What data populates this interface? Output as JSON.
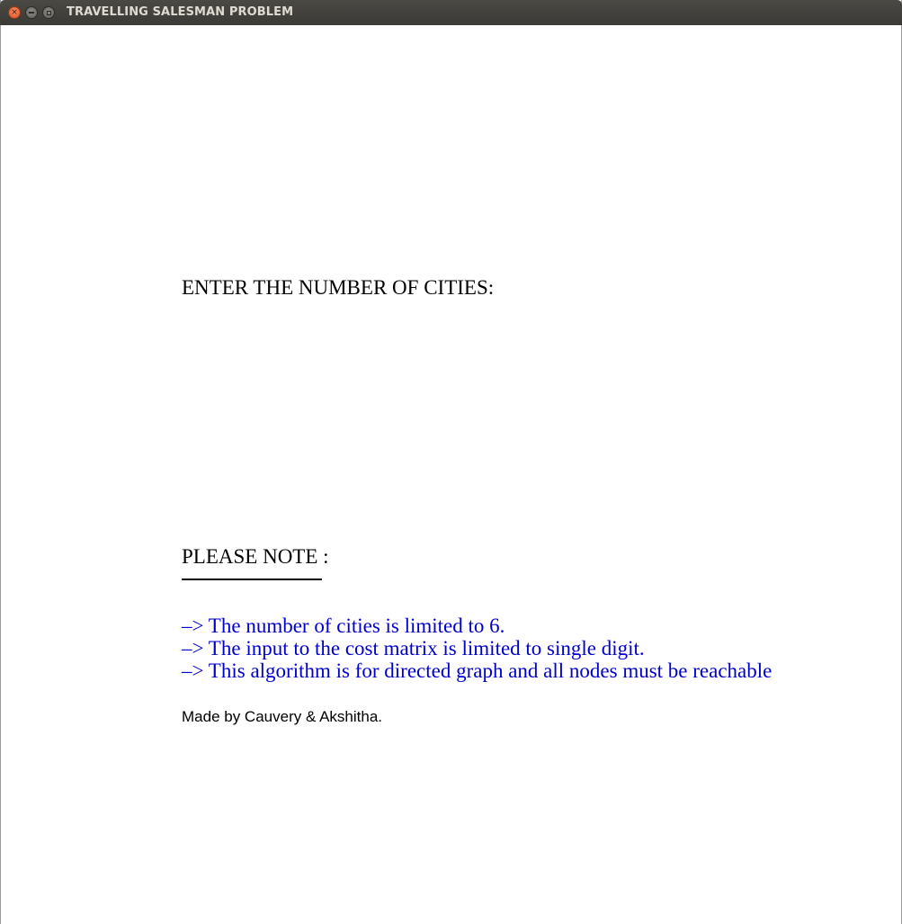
{
  "window": {
    "title": "TRAVELLING SALESMAN PROBLEM",
    "close_glyph": "×",
    "accent_close": "#e0531f"
  },
  "main": {
    "prompt": "ENTER THE NUMBER OF CITIES:",
    "note_heading": "PLEASE NOTE :",
    "notes": [
      "–> The number of cities is limited to 6.",
      "–> The input to the cost matrix is limited to single digit.",
      "–> This algorithm  is for directed graph and all nodes must be reachable"
    ],
    "note_color": "#0000cc",
    "credit": "Made by Cauvery & Akshitha."
  }
}
